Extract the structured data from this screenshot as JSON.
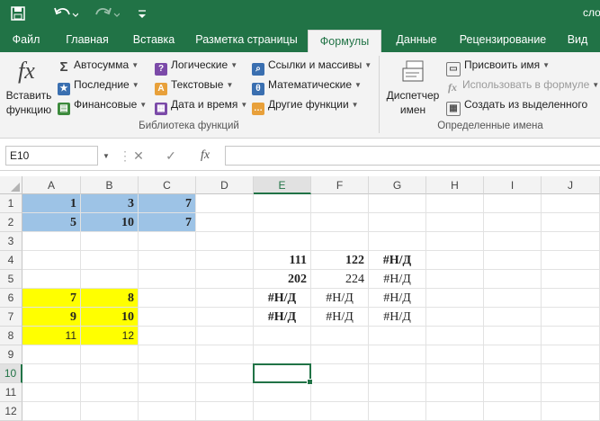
{
  "app": {
    "title": "сло",
    "quick_access": {
      "save_icon": "save-icon",
      "undo_icon": "undo-icon",
      "redo_icon": "redo-icon",
      "customize_icon": "customize-qat-icon"
    }
  },
  "tabs": [
    "Файл",
    "Главная",
    "Вставка",
    "Разметка страницы",
    "Формулы",
    "Данные",
    "Рецензирование",
    "Вид"
  ],
  "active_tab": "Формулы",
  "ribbon": {
    "insert_function": {
      "icon": "fx",
      "line1": "Вставить",
      "line2": "функцию"
    },
    "library": {
      "col1": [
        "Автосумма",
        "Последние",
        "Финансовые"
      ],
      "col2": [
        "Логические",
        "Текстовые",
        "Дата и время"
      ],
      "col3": [
        "Ссылки и массивы",
        "Математические",
        "Другие функции"
      ],
      "label": "Библиотека функций"
    },
    "names": {
      "manager_line1": "Диспетчер",
      "manager_line2": "имен",
      "assign": "Присвоить имя",
      "use_in_formula": "Использовать в формуле",
      "create_from_selection": "Создать из выделенного",
      "label": "Определенные имена"
    }
  },
  "formula_bar": {
    "name_box": "E10",
    "formula": "",
    "cancel_icon": "✕",
    "enter_icon": "✓",
    "fx_icon": "fx"
  },
  "grid": {
    "columns": [
      "A",
      "B",
      "C",
      "D",
      "E",
      "F",
      "G",
      "H",
      "I",
      "J"
    ],
    "rows": [
      "1",
      "2",
      "3",
      "4",
      "5",
      "6",
      "7",
      "8",
      "9",
      "10",
      "11",
      "12"
    ],
    "selected_column": "E",
    "selected_row": "10",
    "cells": {
      "A1": "1",
      "B1": "3",
      "C1": "7",
      "A2": "5",
      "B2": "10",
      "C2": "7",
      "E4": "111",
      "F4": "122",
      "G4": "#Н/Д",
      "E5": "202",
      "F5": "224",
      "G5": "#Н/Д",
      "A6": "7",
      "B6": "8",
      "E6": "#Н/Д",
      "F6": "#Н/Д",
      "G6": "#Н/Д",
      "A7": "9",
      "B7": "10",
      "E7": "#Н/Д",
      "F7": "#Н/Д",
      "G7": "#Н/Д",
      "A8": "11",
      "B8": "12"
    },
    "fill_colors": {
      "blue": "#9dc3e6",
      "yellow": "#ffff00"
    }
  },
  "colors": {
    "accent": "#217346"
  }
}
